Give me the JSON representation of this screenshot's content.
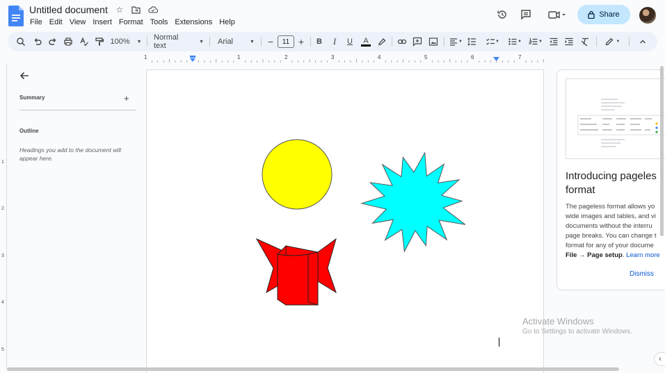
{
  "header": {
    "title": "Untitled document",
    "menus": [
      "File",
      "Edit",
      "View",
      "Insert",
      "Format",
      "Tools",
      "Extensions",
      "Help"
    ],
    "share_label": "Share",
    "icons": [
      "star-icon",
      "move-folder-icon",
      "cloud-saved-icon",
      "history-icon",
      "comment-icon",
      "meet-icon",
      "lock-icon"
    ]
  },
  "toolbar": {
    "zoom": "100%",
    "style": "Normal text",
    "font": "Arial",
    "font_size": "11"
  },
  "ruler": {
    "numbers": [
      "1",
      "1",
      "2",
      "3",
      "4",
      "5",
      "6",
      "7"
    ]
  },
  "vruler": {
    "numbers": [
      "1",
      "2",
      "3",
      "4",
      "5"
    ]
  },
  "outline": {
    "summary_label": "Summary",
    "outline_label": "Outline",
    "hint": "Headings you add to the document will appear here."
  },
  "card": {
    "title_line1": "Introducing pageles",
    "title_line2": "format",
    "body_lines": [
      "The pageless format allows yo",
      "wide images and tables, and vi",
      "documents without the interru",
      "page breaks. You can change t",
      "format for any of your docume"
    ],
    "body_bold": "File → Page setup",
    "body_tail": ".",
    "learn_more": "Learn more",
    "dismiss": "Dismiss"
  },
  "watermark": {
    "title": "Activate Windows",
    "subtitle": "Go to Settings to activate Windows."
  },
  "colors": {
    "circle": "#ffff00",
    "starburst": "#00ffff",
    "ribbon": "#ff0000",
    "share_bg": "#c2e7ff"
  }
}
